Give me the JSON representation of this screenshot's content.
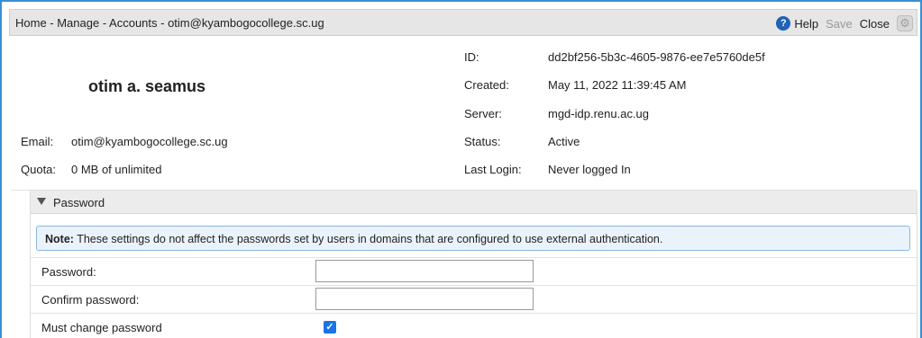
{
  "toolbar": {
    "breadcrumb": "Home - Manage - Accounts - otim@kyambogocollege.sc.ug",
    "help_label": "Help",
    "save_label": "Save",
    "close_label": "Close"
  },
  "account": {
    "display_name": "otim a. seamus",
    "email_label": "Email:",
    "email": "otim@kyambogocollege.sc.ug",
    "quota_label": "Quota:",
    "quota": "0 MB of unlimited",
    "id_label": "ID:",
    "id": "dd2bf256-5b3c-4605-9876-ee7e5760de5f",
    "created_label": "Created:",
    "created": "May 11, 2022 11:39:45 AM",
    "server_label": "Server:",
    "server": "mgd-idp.renu.ac.ug",
    "status_label": "Status:",
    "status": "Active",
    "last_login_label": "Last Login:",
    "last_login": "Never logged In"
  },
  "password_section": {
    "title": "Password",
    "note_bold": "Note:",
    "note_text": " These settings do not affect the passwords set by users in domains that are configured to use external authentication.",
    "password_label": "Password:",
    "password_value": "",
    "confirm_label": "Confirm password:",
    "confirm_value": "",
    "must_change_label": "Must change password",
    "must_change_checked": true
  },
  "colors": {
    "frame_border": "#3a8fd4",
    "help_icon": "#1f62b8",
    "checkbox": "#1a73e8",
    "note_bg": "#eaf3fc",
    "note_border": "#8ab7e2"
  },
  "icons": [
    "help-icon",
    "gear-icon",
    "triangle-down-icon",
    "checkmark-icon"
  ]
}
